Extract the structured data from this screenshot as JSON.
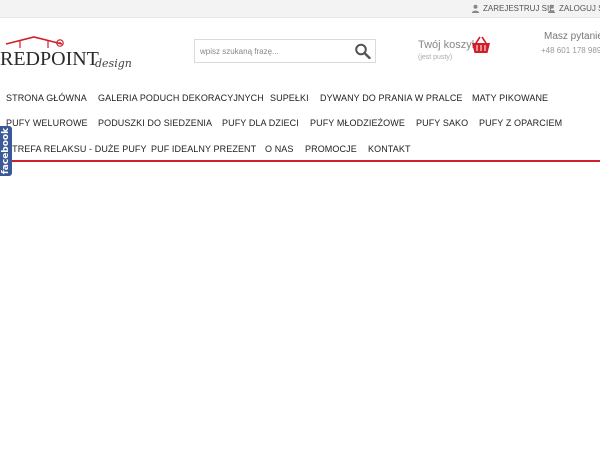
{
  "topbar": {
    "register_label": "ZAREJESTRUJ SIĘ",
    "login_label": "ZALOGUJ SIĘ"
  },
  "logo": {
    "brand": "REDPOINT",
    "sub": "design"
  },
  "search": {
    "placeholder": "wpisz szukaną frazę..."
  },
  "cart": {
    "title": "Twój koszyk",
    "status": "(jest pusty)"
  },
  "contact": {
    "question": "Masz pytanie",
    "phone": "+48 601 178 989"
  },
  "nav": {
    "items": [
      "STRONA GŁÓWNA",
      "GALERIA PODUCH DEKORACYJNYCH",
      "SUPEŁKI",
      "DYWANY DO PRANIA W PRALCE",
      "MATY PIKOWANE",
      "PUFY WELUROWE",
      "PODUSZKI DO SIEDZENIA",
      "PUFY DLA DZIECI",
      "PUFY MŁODZIEŻOWE",
      "PUFY SAKO",
      "PUFY Z OPARCIEM",
      "STREFA RELAKSU - DUŻE PUFY",
      "PUF IDEALNY PREZENT",
      "O NAS",
      "PROMOCJE",
      "KONTAKT"
    ]
  },
  "facebook_tab": {
    "label": "facebook"
  },
  "colors": {
    "accent": "#d01f2a",
    "facebook": "#3b5998",
    "topbar_bg": "#f3f3f3"
  }
}
